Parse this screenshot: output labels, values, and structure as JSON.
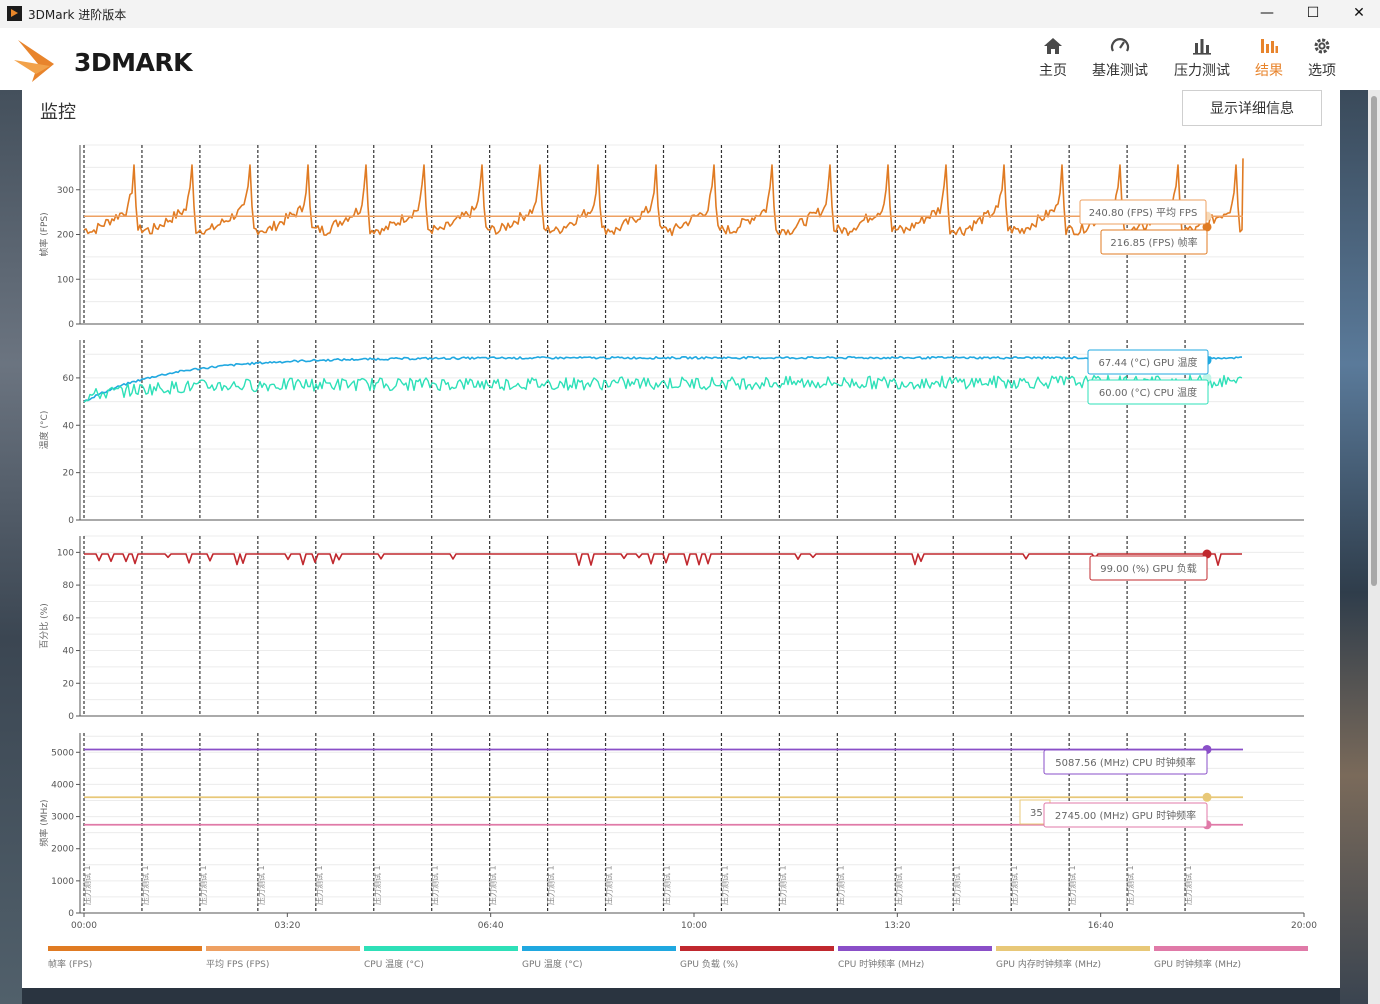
{
  "window": {
    "title": "3DMark 进阶版本",
    "minimize": "—",
    "maximize": "☐",
    "close": "✕"
  },
  "header": {
    "logo_text": "3DMARK",
    "nav": [
      {
        "label": "主页",
        "icon": "home-icon"
      },
      {
        "label": "基准测试",
        "icon": "gauge-icon"
      },
      {
        "label": "压力测试",
        "icon": "bar-chart-icon"
      },
      {
        "label": "结果",
        "icon": "results-icon",
        "active": true
      },
      {
        "label": "选项",
        "icon": "gear-icon"
      }
    ],
    "active_color": "#e8842c"
  },
  "panel": {
    "title": "监控",
    "detail_button": "显示详细信息"
  },
  "colors": {
    "fps": "#e07b23",
    "avg_fps": "#eea062",
    "cpu_temp": "#2ee0b8",
    "gpu_temp": "#20a8e0",
    "gpu_load": "#c0282e",
    "cpu_clock": "#8a4fc8",
    "gpu_mem_clock": "#e8c878",
    "gpu_clock": "#e07aa8"
  },
  "marker_label": "压力测试 1",
  "chart_data": [
    {
      "type": "line",
      "ylabel": "帧率 (FPS)",
      "yticks": [
        0,
        100,
        200,
        300
      ],
      "ylim": [
        0,
        400
      ],
      "series": [
        {
          "name": "帧率 (FPS)",
          "pattern": "sawtooth",
          "base": 205,
          "peak": 355,
          "end_value": 216.85
        },
        {
          "name": "平均 FPS (FPS)",
          "pattern": "flat",
          "value": 240.8
        }
      ],
      "callouts": [
        {
          "text": "240.80 (FPS) 平均 FPS"
        },
        {
          "text": "216.85 (FPS) 帧率"
        }
      ]
    },
    {
      "type": "line",
      "ylabel": "温度 (°C)",
      "yticks": [
        0,
        20,
        40,
        60
      ],
      "ylim": [
        0,
        76
      ],
      "series": [
        {
          "name": "GPU 温度 (°C)",
          "start": 50,
          "plateau": 68.5,
          "end_value": 67.44
        },
        {
          "name": "CPU 温度 (°C)",
          "start": 52,
          "plateau": 57,
          "end_value": 60.0
        }
      ],
      "callouts": [
        {
          "text": "67.44 (°C) GPU 温度"
        },
        {
          "text": "60.00 (°C) CPU 温度"
        }
      ]
    },
    {
      "type": "line",
      "ylabel": "百分比 (%)",
      "yticks": [
        0,
        20,
        40,
        60,
        80,
        100
      ],
      "ylim": [
        0,
        110
      ],
      "series": [
        {
          "name": "GPU 负载 (%)",
          "value": 99.0,
          "end_value": 99.0
        }
      ],
      "callouts": [
        {
          "text": "99.00 (%) GPU 负载"
        }
      ]
    },
    {
      "type": "line",
      "ylabel": "频率 (MHz)",
      "yticks": [
        0,
        1000,
        2000,
        3000,
        4000,
        5000
      ],
      "ylim": [
        0,
        5600
      ],
      "series": [
        {
          "name": "CPU 时钟频率 (MHz)",
          "value": 5087.56
        },
        {
          "name": "GPU 内存时钟频率 (MHz)",
          "value": 3600
        },
        {
          "name": "GPU 时钟频率 (MHz)",
          "value": 2745.0
        }
      ],
      "callouts": [
        {
          "text": "5087.56 (MHz) CPU 时钟频率"
        },
        {
          "text": "2745.00 (MHz) GPU 时钟频率"
        },
        {
          "text": "35"
        }
      ]
    }
  ],
  "x_axis": {
    "ticks": [
      "00:00",
      "03:20",
      "06:40",
      "10:00",
      "13:20",
      "16:40",
      "20:00"
    ],
    "xlim_seconds": [
      0,
      1200
    ],
    "marker_count": 20,
    "marker_interval_seconds": 57
  },
  "legend": [
    {
      "label": "帧率 (FPS)",
      "color": "#e07b23"
    },
    {
      "label": "平均 FPS (FPS)",
      "color": "#eea062"
    },
    {
      "label": "CPU 温度 (°C)",
      "color": "#2ee0b8"
    },
    {
      "label": "GPU 温度 (°C)",
      "color": "#20a8e0"
    },
    {
      "label": "GPU 负载 (%)",
      "color": "#c0282e"
    },
    {
      "label": "CPU 时钟频率 (MHz)",
      "color": "#8a4fc8"
    },
    {
      "label": "GPU 内存时钟频率 (MHz)",
      "color": "#e8c878"
    },
    {
      "label": "GPU 时钟频率 (MHz)",
      "color": "#e07aa8"
    }
  ]
}
